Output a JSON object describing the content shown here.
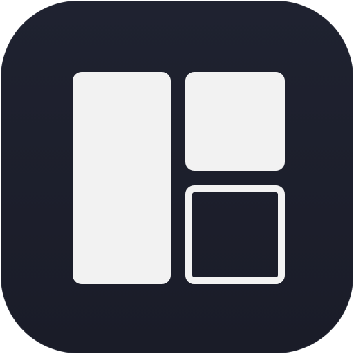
{
  "icon": {
    "name": "layout-panels-icon",
    "background_color": "#1c1e2b",
    "glyph_color": "#f2f2f2"
  }
}
